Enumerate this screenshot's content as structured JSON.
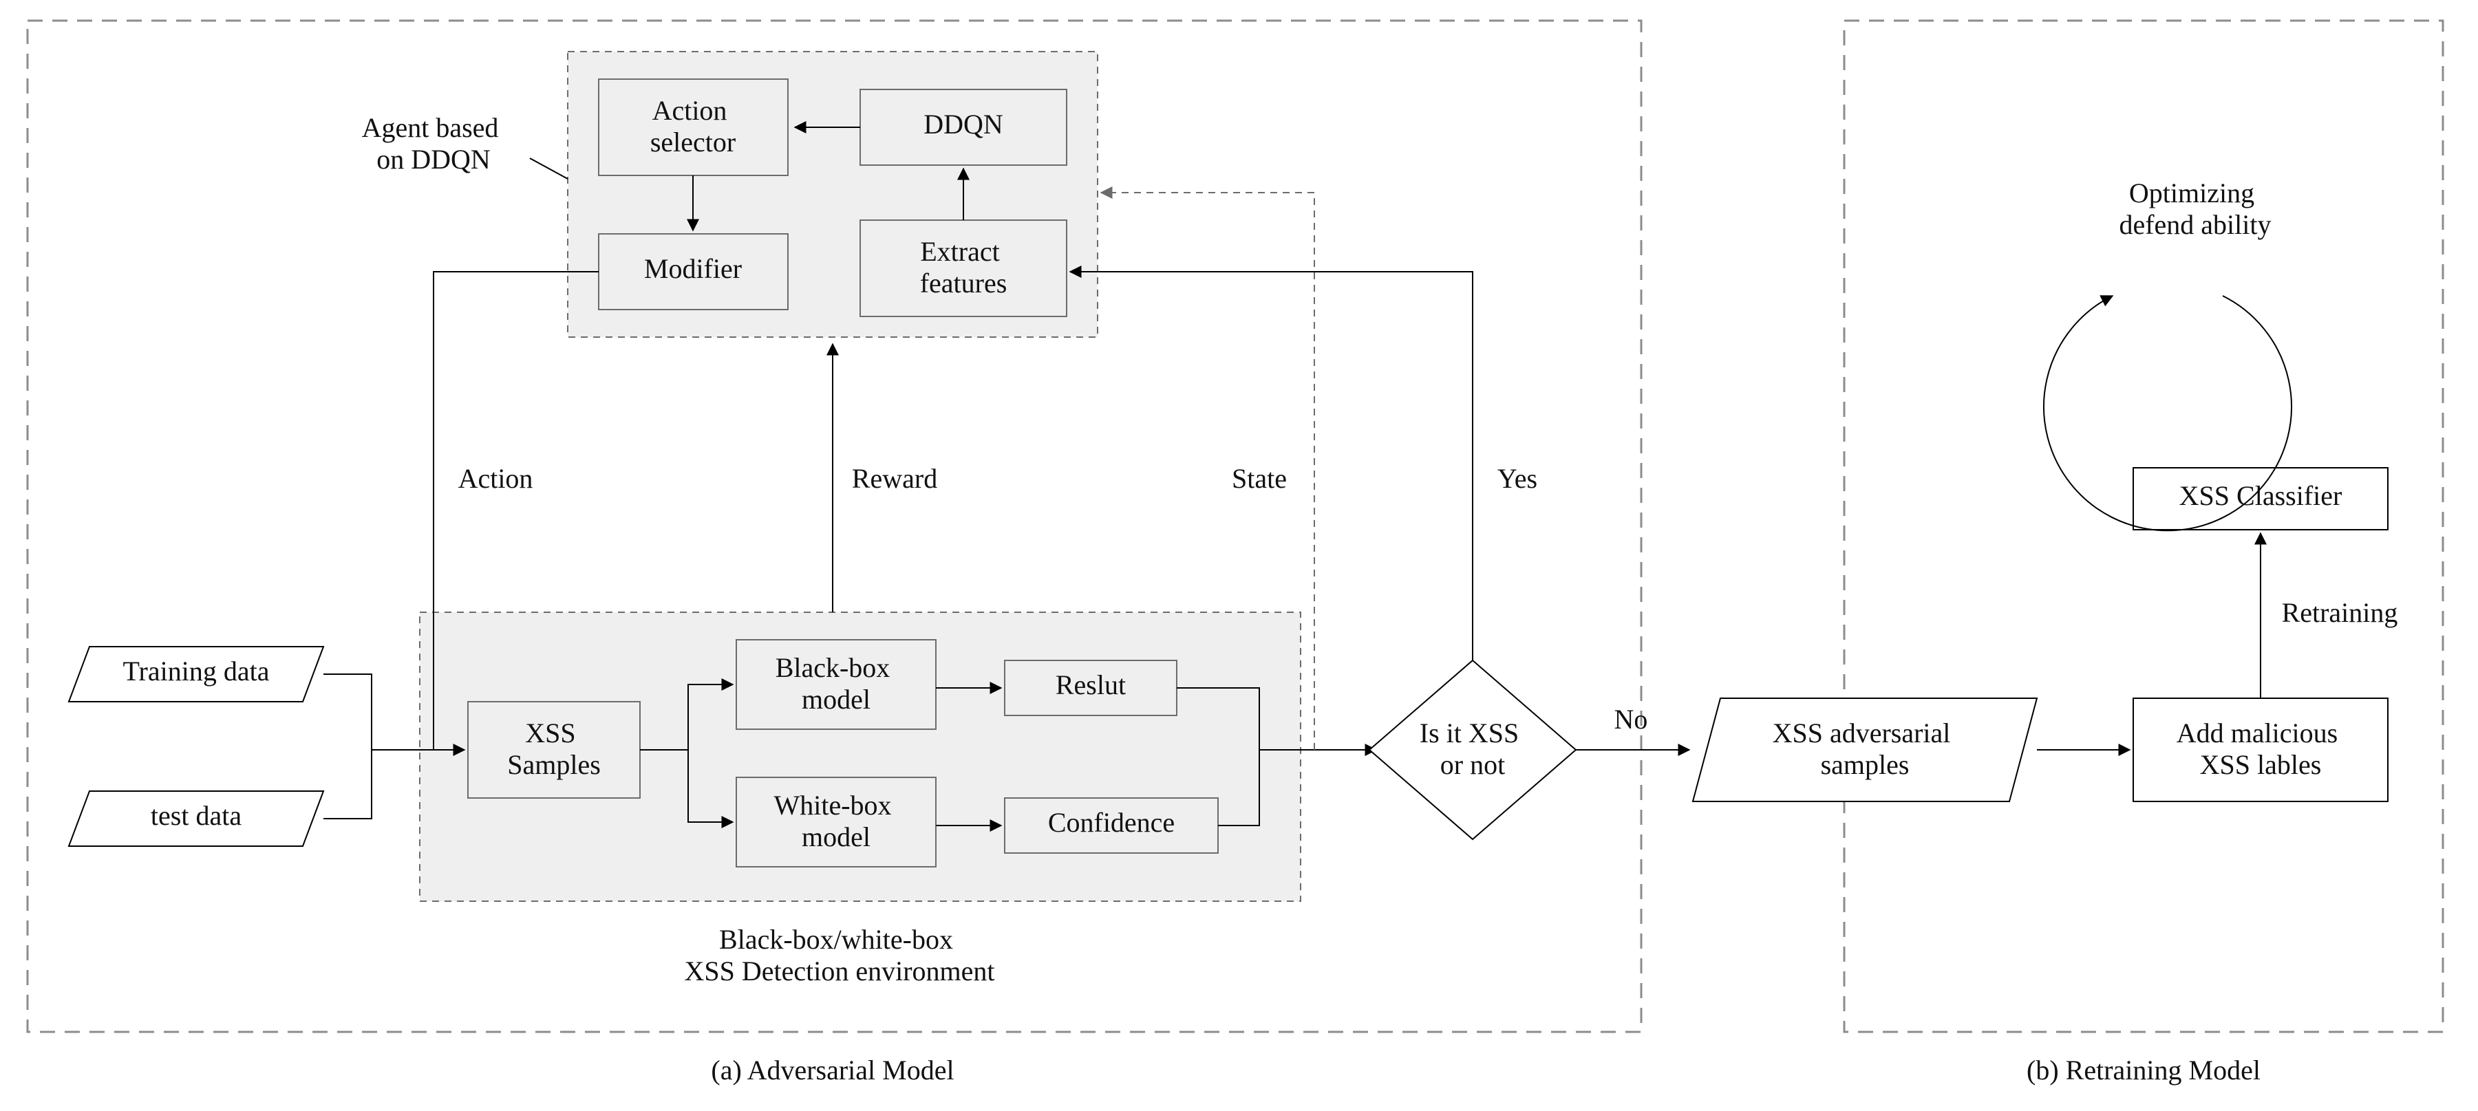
{
  "agent": {
    "title": "Agent based\non DDQN",
    "action_selector": "Action\nselector",
    "ddqn": "DDQN",
    "modifier": "Modifier",
    "extract": "Extract\nfeatures"
  },
  "env": {
    "title": "Black-box/white-box\nXSS Detection environment",
    "xss_samples": "XSS\nSamples",
    "blackbox": "Black-box\nmodel",
    "whitebox": "White-box\nmodel",
    "result": "Reslut",
    "confidence": "Confidence"
  },
  "inputs": {
    "training": "Training data",
    "test": "test data"
  },
  "edges": {
    "action": "Action",
    "reward": "Reward",
    "state": "State",
    "yes": "Yes",
    "no": "No"
  },
  "decision": "Is it XSS\nor not",
  "adv_samples": "XSS adversarial\nsamples",
  "retraining": {
    "add_labels": "Add malicious\nXSS lables",
    "flow_label": "Retraining",
    "classifier": "XSS Classifier",
    "optimize": "Optimizing\ndefend ability"
  },
  "captions": {
    "a": "(a) Adversarial Model",
    "b": "(b) Retraining Model"
  }
}
